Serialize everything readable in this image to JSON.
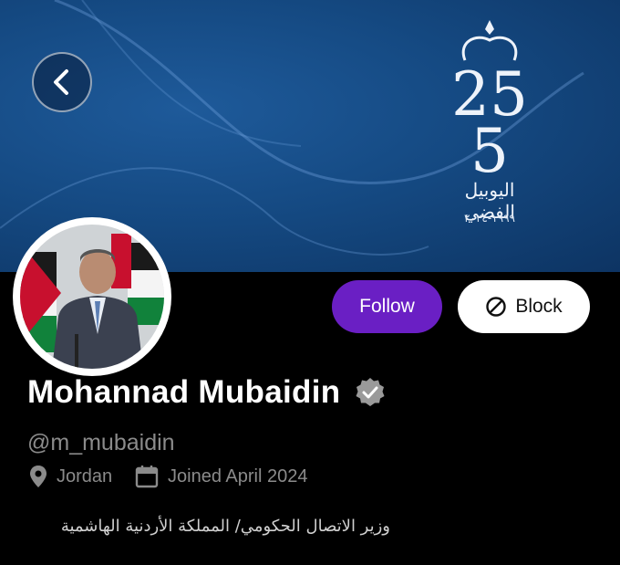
{
  "banner": {
    "background": "#154a83",
    "emblem_number": "25",
    "emblem_script": "اليوبيل الفضي",
    "emblem_years": "١٩٩٩-٢٠٢٤"
  },
  "nav": {
    "back_icon": "chevron-left-icon"
  },
  "actions": {
    "follow_label": "Follow",
    "follow_color": "#6a1fc4",
    "block_label": "Block",
    "block_icon": "block-icon"
  },
  "profile": {
    "name": "Mohannad Mubaidin",
    "verified_icon": "verified-badge-icon",
    "handle": "@m_mubaidin",
    "location": "Jordan",
    "location_icon": "location-pin-icon",
    "joined": "Joined April 2024",
    "joined_icon": "calendar-icon",
    "bio": "وزير الاتصال الحكومي/ المملكة الأردنية الهاشمية"
  }
}
